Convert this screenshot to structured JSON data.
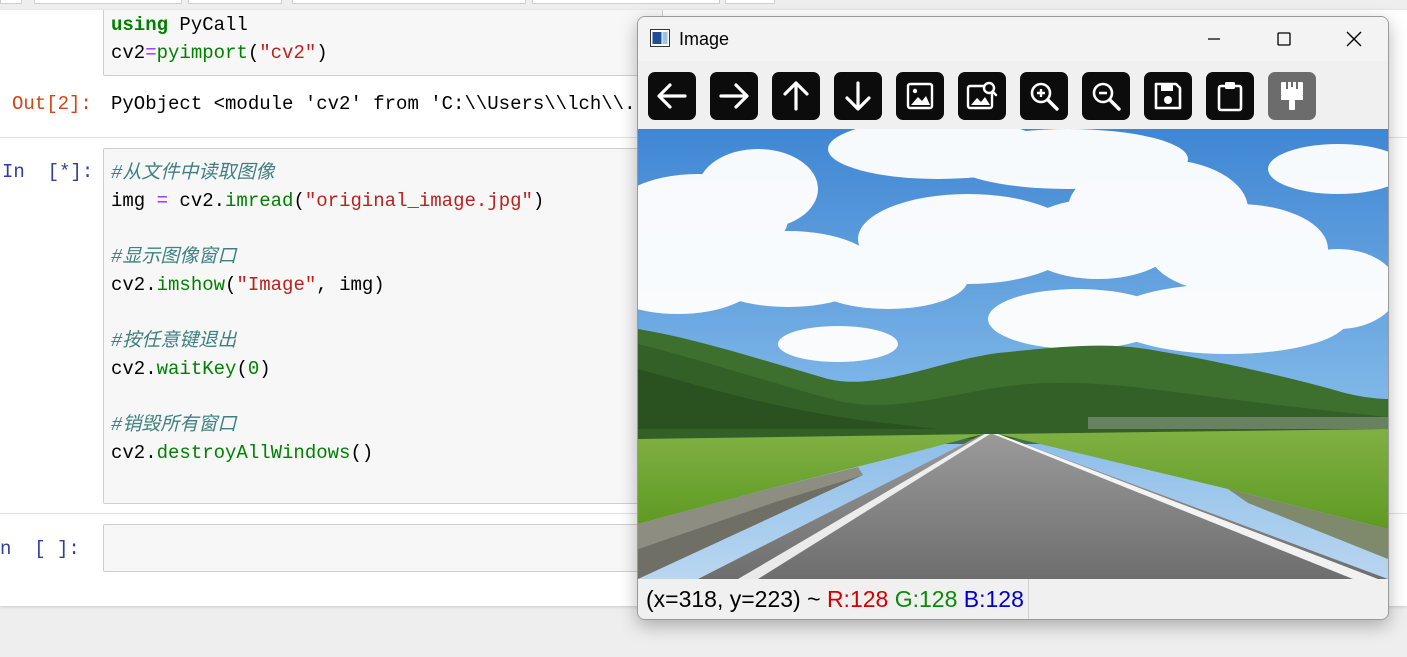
{
  "notebook": {
    "cell_using": {
      "lines": [
        {
          "kw": "using",
          "rest": " PyCall"
        },
        {
          "var": "cv2",
          "op": "=",
          "fn": "pyimport",
          "open": "(",
          "str": "\"cv2\"",
          "close": ")"
        }
      ]
    },
    "out2": {
      "prompt": "Out[2]:",
      "text": "PyObject <module 'cv2' from 'C:\\\\Users\\\\lch\\\\."
    },
    "cell_main": {
      "prompt": "In  [*]:",
      "comment_read": "#从文件中读取图像",
      "read_prefix": "img ",
      "read_eq": "=",
      "read_mod": " cv2.",
      "read_fn": "imread",
      "read_open": "(",
      "read_str": "\"original_image.jpg\"",
      "read_close": ")",
      "comment_show": "#显示图像窗口",
      "show_mod": "cv2.",
      "show_fn": "imshow",
      "show_open": "(",
      "show_str": "\"Image\"",
      "show_rest": ", img)",
      "comment_wait": "#按任意键退出",
      "wait_mod": "cv2.",
      "wait_fn": "waitKey",
      "wait_open": "(",
      "wait_num": "0",
      "wait_close": ")",
      "comment_destroy": "#销毁所有窗口",
      "destroy_mod": "cv2.",
      "destroy_fn": "destroyAllWindows",
      "destroy_rest": "()"
    },
    "cell_empty": {
      "prompt": "n  [ ]:"
    }
  },
  "image_window": {
    "title": "Image",
    "toolbar": [
      {
        "icon": "arrow-left-icon"
      },
      {
        "icon": "arrow-right-icon"
      },
      {
        "icon": "arrow-up-icon"
      },
      {
        "icon": "arrow-down-icon"
      },
      {
        "icon": "image-icon"
      },
      {
        "icon": "image-search-icon"
      },
      {
        "icon": "zoom-in-icon"
      },
      {
        "icon": "zoom-out-icon"
      },
      {
        "icon": "save-icon"
      },
      {
        "icon": "clipboard-icon"
      },
      {
        "icon": "properties-brush-icon",
        "disabled": true
      }
    ],
    "status": {
      "coords": "(x=318, y=223) ~ ",
      "r": "R:128",
      "g": "G:128",
      "b": "B:128"
    }
  },
  "colors": {
    "prompt_in": "#303f9f",
    "prompt_out": "#d84315",
    "keyword": "#008000",
    "string": "#ba2121",
    "comment": "#408080"
  }
}
